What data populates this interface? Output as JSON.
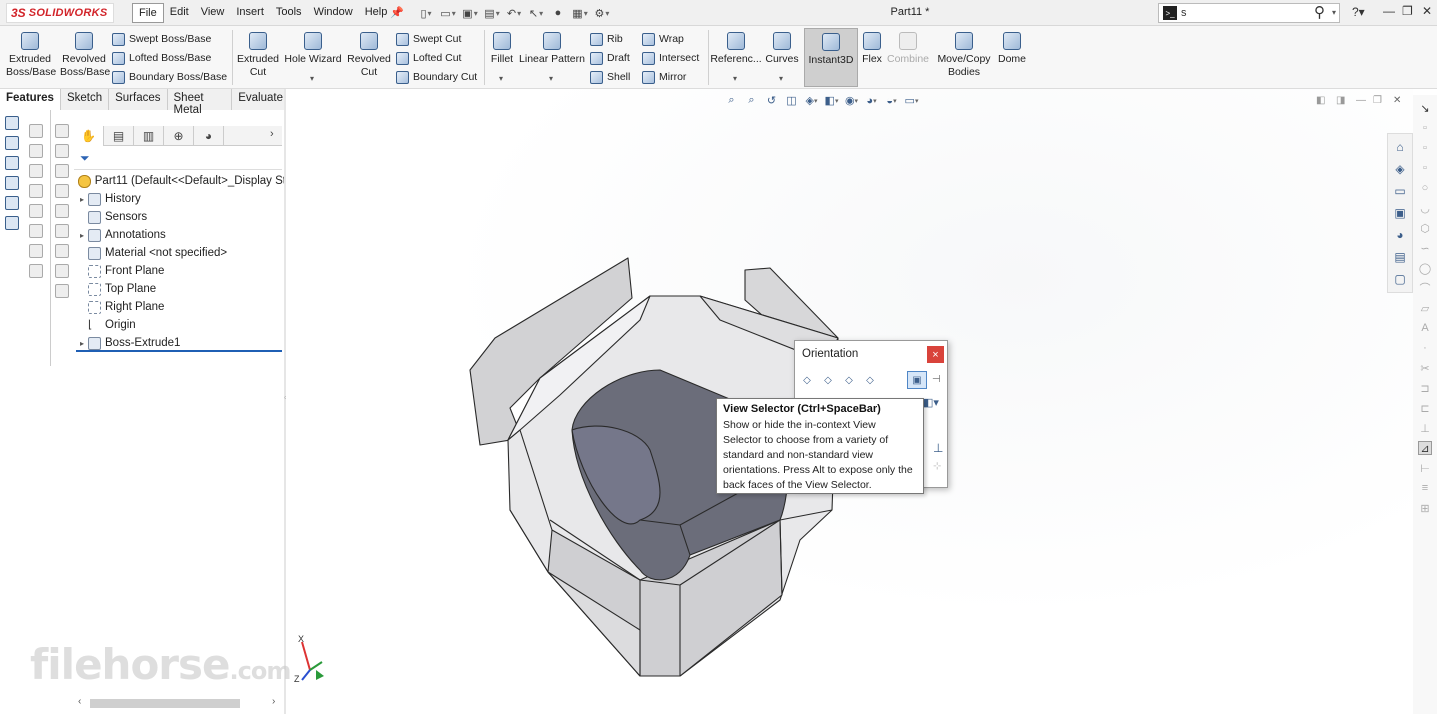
{
  "app": {
    "logo_ds": "3S",
    "logo_text": "SOLIDWORKS",
    "doc_title": "Part11 *"
  },
  "menu": {
    "items": [
      "File",
      "Edit",
      "View",
      "Insert",
      "Tools",
      "Window",
      "Help"
    ]
  },
  "search": {
    "value": "s"
  },
  "ribbon": {
    "extruded_boss": "Extruded\nBoss/Base",
    "extruded_boss_l1": "Extruded",
    "extruded_boss_l2": "Boss/Base",
    "revolved_boss_l1": "Revolved",
    "revolved_boss_l2": "Boss/Base",
    "swept_boss": "Swept Boss/Base",
    "lofted_boss": "Lofted Boss/Base",
    "boundary_boss": "Boundary Boss/Base",
    "extruded_cut_l1": "Extruded",
    "extruded_cut_l2": "Cut",
    "hole_wizard": "Hole Wizard",
    "revolved_cut_l1": "Revolved",
    "revolved_cut_l2": "Cut",
    "swept_cut": "Swept Cut",
    "lofted_cut": "Lofted Cut",
    "boundary_cut": "Boundary Cut",
    "fillet": "Fillet",
    "linear_pattern": "Linear Pattern",
    "rib": "Rib",
    "draft": "Draft",
    "shell": "Shell",
    "wrap": "Wrap",
    "intersect": "Intersect",
    "mirror": "Mirror",
    "reference": "Referenc...",
    "curves": "Curves",
    "instant3d": "Instant3D",
    "flex": "Flex",
    "combine": "Combine",
    "move_copy_l1": "Move/Copy",
    "move_copy_l2": "Bodies",
    "dome": "Dome"
  },
  "tabs": [
    "Features",
    "Sketch",
    "Surfaces",
    "Sheet Metal",
    "Evaluate"
  ],
  "tree": {
    "root": "Part11  (Default<<Default>_Display St",
    "items": [
      {
        "label": "History",
        "expandable": true
      },
      {
        "label": "Sensors",
        "expandable": false
      },
      {
        "label": "Annotations",
        "expandable": true
      },
      {
        "label": "Material <not specified>",
        "expandable": false
      },
      {
        "label": "Front Plane",
        "expandable": false
      },
      {
        "label": "Top Plane",
        "expandable": false
      },
      {
        "label": "Right Plane",
        "expandable": false
      },
      {
        "label": "Origin",
        "expandable": false
      },
      {
        "label": "Boss-Extrude1",
        "expandable": true
      }
    ]
  },
  "orientation": {
    "title": "Orientation",
    "close": "×"
  },
  "tooltip": {
    "title": "View Selector   (Ctrl+SpaceBar)",
    "body": "Show or hide the in-context View Selector to choose from a variety of standard and non-standard view orientations. Press Alt to expose only the back faces of the View Selector."
  },
  "triad": {
    "x": "X",
    "z": "Z"
  },
  "watermark": {
    "main": "filehorse",
    "suffix": ".com"
  },
  "colors": {
    "brand_red": "#d2242a",
    "selection_blue": "#1f5fb4",
    "cylinder": "#6b6d7a"
  }
}
